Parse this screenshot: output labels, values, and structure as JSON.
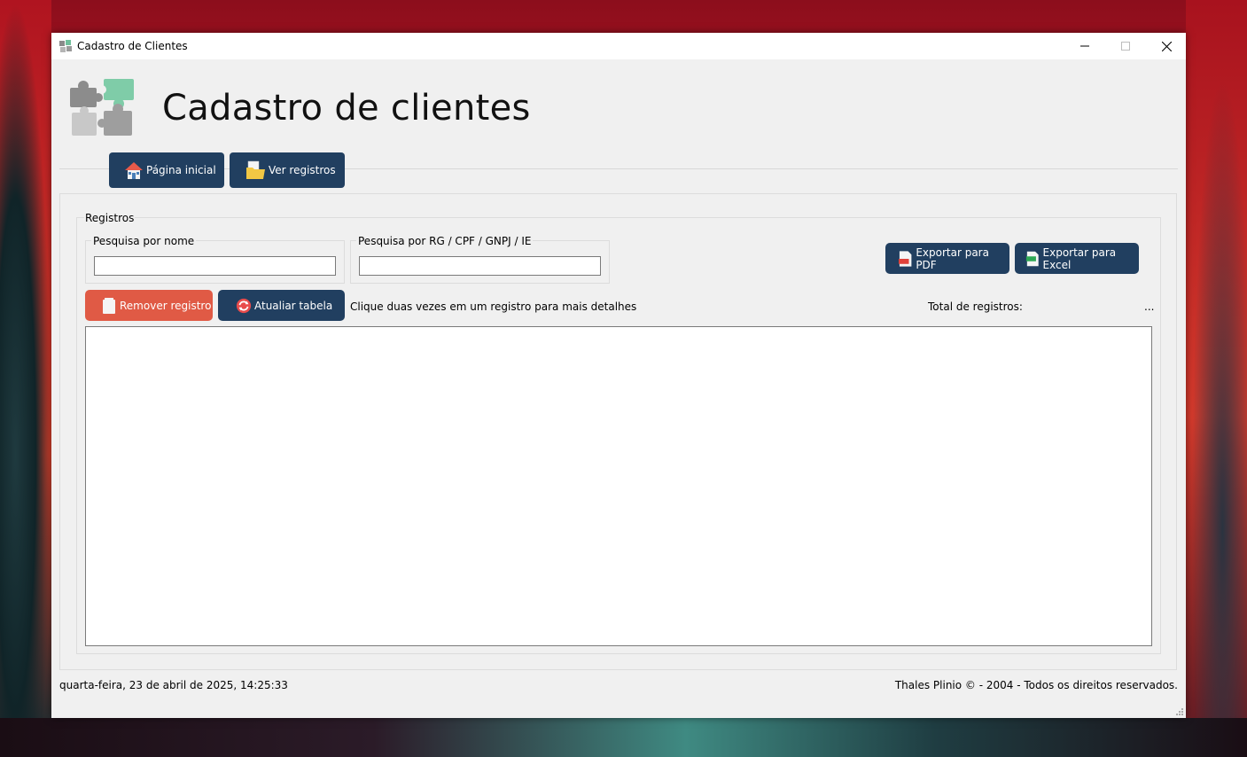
{
  "window": {
    "title": "Cadastro de Clientes"
  },
  "header": {
    "title": "Cadastro de clientes",
    "icon": "puzzle-pieces-icon"
  },
  "nav": {
    "home_label": "Página inicial",
    "records_label": "Ver registros"
  },
  "registros": {
    "group_label": "Registros",
    "search_name": {
      "label": "Pesquisa por nome",
      "value": ""
    },
    "search_doc": {
      "label": "Pesquisa por RG / CPF / GNPJ / IE",
      "value": ""
    },
    "export_pdf_label": "Exportar para PDF",
    "export_excel_label": "Exportar para Excel",
    "remove_label": "Remover registro",
    "refresh_label": "Atualiar tabela",
    "hint": "Clique duas vezes em um registro para mais detalhes",
    "total_label": "Total de registros:",
    "total_value": "..."
  },
  "status": {
    "datetime": "quarta-feira, 23 de abril de 2025,  14:25:33",
    "copyright": "Thales Plinio © - 2004 - Todos os direitos reservados."
  },
  "colors": {
    "primary_button": "#213f60",
    "danger_button": "#e05a45",
    "window_bg": "#f0f0f0"
  }
}
